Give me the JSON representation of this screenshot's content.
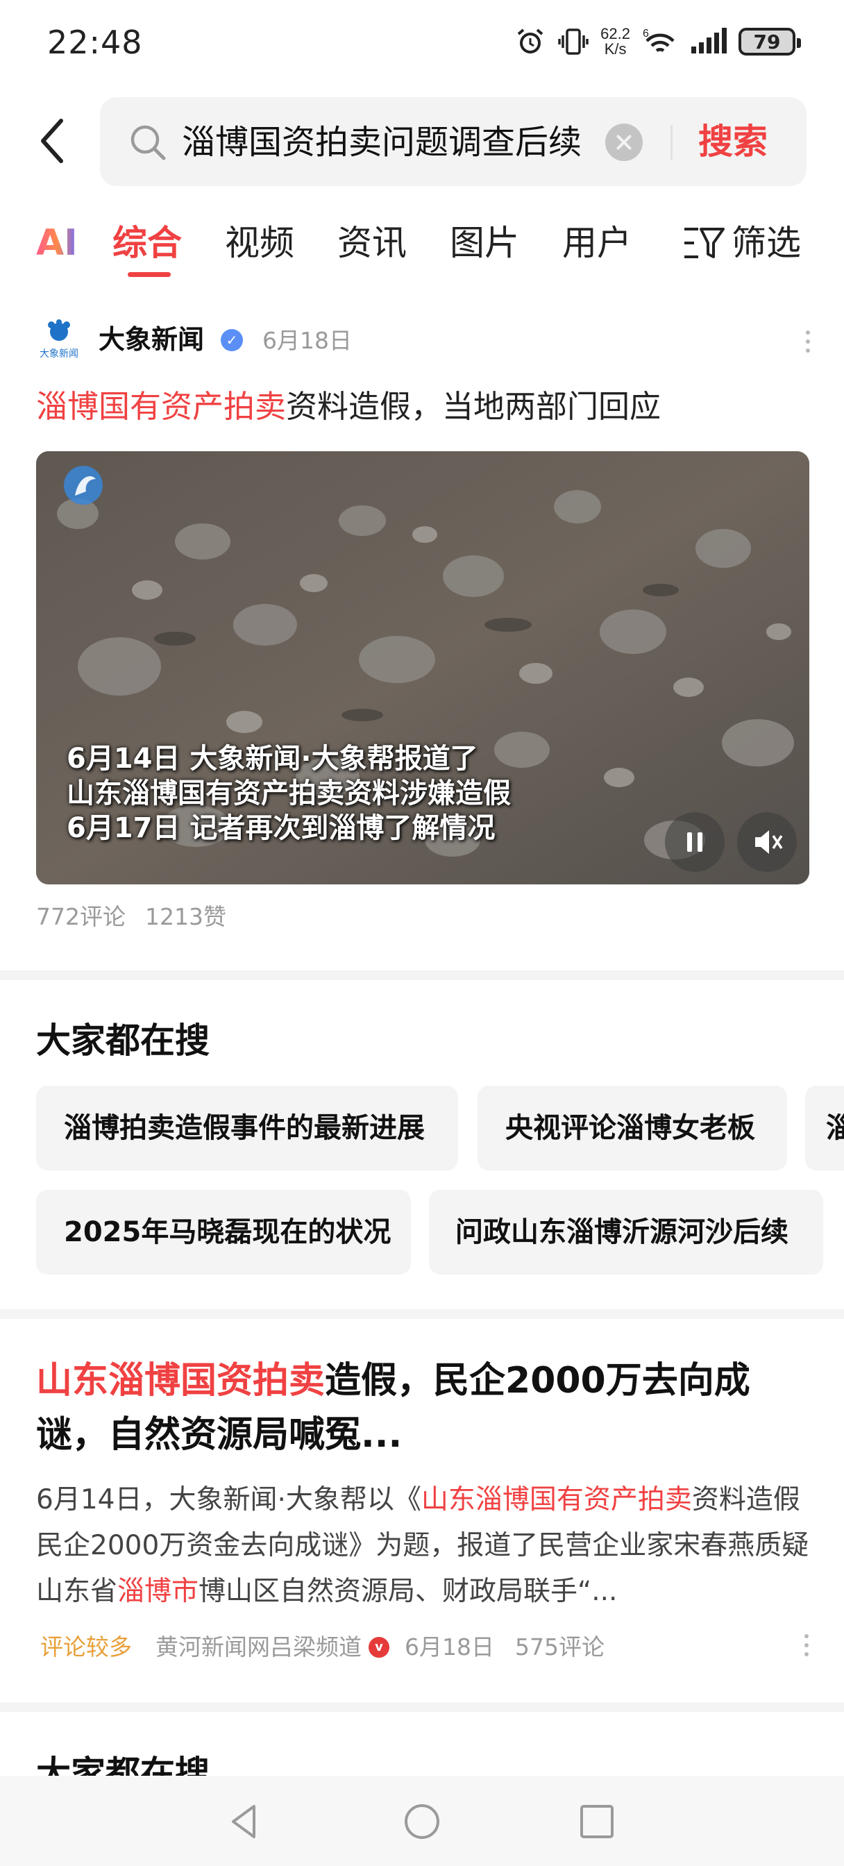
{
  "status_bar": {
    "time": "22:48",
    "net_speed_value": "62.2",
    "net_speed_unit": "K/s",
    "wifi_label": "6",
    "battery": "79",
    "icons": [
      "alarm-icon",
      "vibrate-icon",
      "wifi-icon",
      "signal-icon",
      "battery-icon"
    ]
  },
  "search": {
    "query": "淄博国资拍卖问题调查后续",
    "button_label": "搜索"
  },
  "tabs": [
    {
      "label": "AI"
    },
    {
      "label": "综合"
    },
    {
      "label": "视频"
    },
    {
      "label": "资讯"
    },
    {
      "label": "图片"
    },
    {
      "label": "用户"
    }
  ],
  "active_tab": "综合",
  "filter_label": "筛选",
  "article1": {
    "source": "大象新闻",
    "logo_text": "大象新闻",
    "date": "6月18日",
    "title_highlight": "淄博国有资产拍卖",
    "title_rest": "资料造假，当地两部门回应",
    "video_caption": [
      "6月14日 大象新闻·大象帮报道了",
      "山东淄博国有资产拍卖资料涉嫌造假",
      "6月17日 记者再次到淄博了解情况"
    ],
    "comments": "772评论",
    "likes": "1213赞"
  },
  "everyone_searches": {
    "title": "大家都在搜",
    "row1": [
      "淄博拍卖造假事件的最新进展",
      "央视评论淄博女老板",
      "淄"
    ],
    "row2": [
      "2025年马晓磊现在的状况",
      "问政山东淄博沂源河沙后续"
    ]
  },
  "article2": {
    "title_highlight": "山东淄博国资拍卖",
    "title_rest": "造假，民企2000万去向成谜，自然资源局喊冤...",
    "body_1": "6月14日，大象新闻·大象帮以《",
    "body_hl_1": "山东淄博国有资产拍卖",
    "body_2": "资料造假 民企2000万资金去向成谜》为题，报道了民营企业家宋春燕质疑山东省",
    "body_hl_2": "淄博市",
    "body_3": "博山区自然资源局、财政局联手“...",
    "tag": "评论较多",
    "source": "黄河新闻网吕梁频道",
    "date": "6月18日",
    "comments": "575评论"
  },
  "next_section_title": "大家都在搜",
  "colors": {
    "accent": "#f04142",
    "muted": "#9a9a9a",
    "tag_orange": "#e8a03b",
    "verified_blue": "#5b8ff5"
  }
}
